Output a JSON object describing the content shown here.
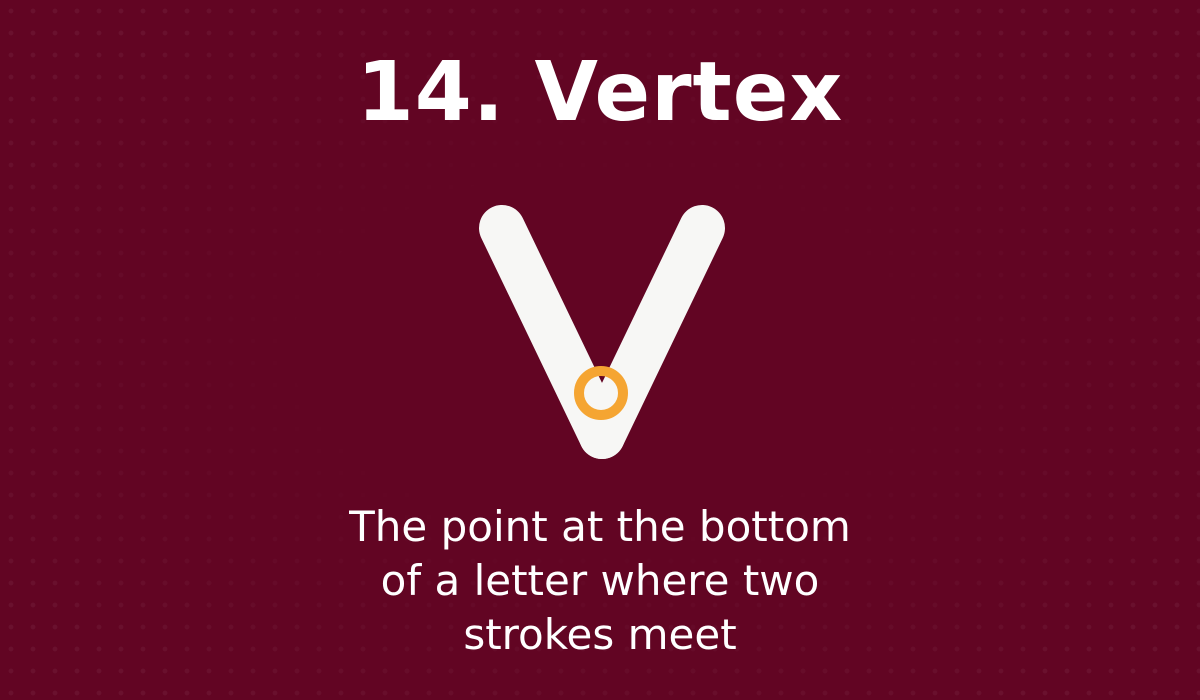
{
  "title": "14. Vertex",
  "illustration": {
    "letter": "V",
    "letter_color": "#f7f7f5",
    "highlight_color": "#f5a532",
    "icon": "vertex-highlight-ring"
  },
  "caption": {
    "lines": [
      "The point at the bottom",
      "of a letter where two",
      "strokes meet"
    ]
  },
  "colors": {
    "background": "#620523",
    "text": "#ffffff"
  }
}
